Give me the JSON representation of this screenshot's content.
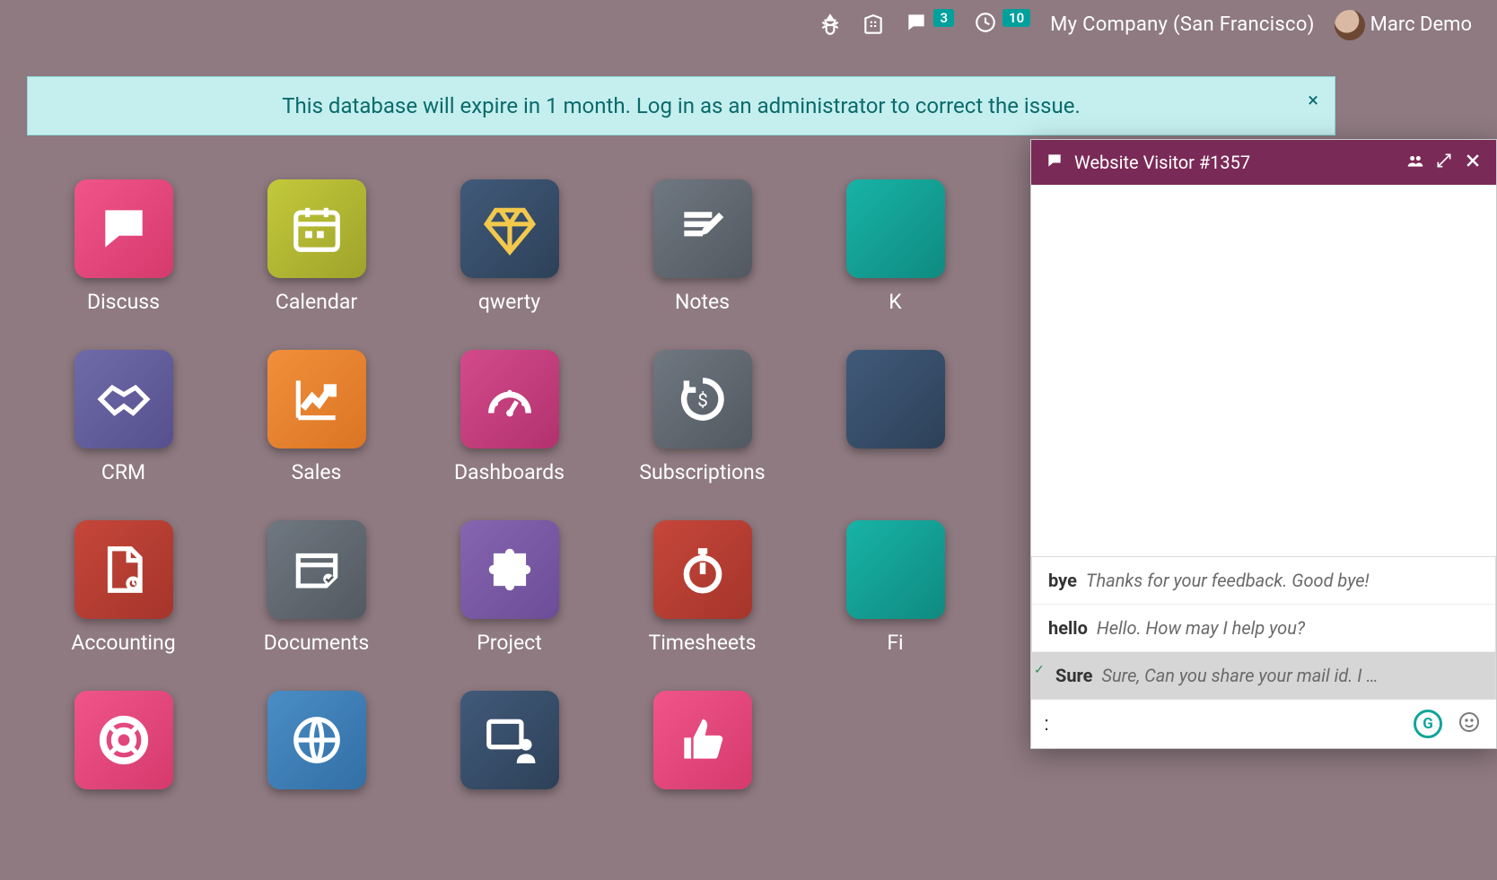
{
  "navbar": {
    "messages_badge": "3",
    "activities_badge": "10",
    "company": "My Company (San Francisco)",
    "user_name": "Marc Demo"
  },
  "alert": {
    "text": "This database will expire in 1 month. Log in as an administrator to correct the issue.",
    "close": "×"
  },
  "apps": [
    {
      "label": "Discuss",
      "tile": "g-pink",
      "icon": "chat"
    },
    {
      "label": "Calendar",
      "tile": "g-olive",
      "icon": "calendar"
    },
    {
      "label": "qwerty",
      "tile": "g-navy",
      "icon": "diamond"
    },
    {
      "label": "Notes",
      "tile": "g-slate",
      "icon": "notes"
    },
    {
      "label": "K",
      "tile": "g-teal",
      "icon": ""
    },
    {
      "label": "CRM",
      "tile": "g-violet",
      "icon": "handshake"
    },
    {
      "label": "Sales",
      "tile": "g-orange",
      "icon": "chart"
    },
    {
      "label": "Dashboards",
      "tile": "g-magenta",
      "icon": "gauge"
    },
    {
      "label": "Subscriptions",
      "tile": "g-slate",
      "icon": "cycle"
    },
    {
      "label": "",
      "tile": "g-navy",
      "icon": ""
    },
    {
      "label": "Accounting",
      "tile": "g-red",
      "icon": "file"
    },
    {
      "label": "Documents",
      "tile": "g-slate",
      "icon": "inbox"
    },
    {
      "label": "Project",
      "tile": "g-purple",
      "icon": "puzzle"
    },
    {
      "label": "Timesheets",
      "tile": "g-red",
      "icon": "timer"
    },
    {
      "label": "Fi",
      "tile": "g-teal",
      "icon": ""
    },
    {
      "label": "",
      "tile": "g-pink",
      "icon": "lifering"
    },
    {
      "label": "",
      "tile": "g-blue",
      "icon": "globe"
    },
    {
      "label": "",
      "tile": "g-navy",
      "icon": "teach"
    },
    {
      "label": "",
      "tile": "g-pink",
      "icon": "thumb"
    }
  ],
  "chat": {
    "title": "Website Visitor #1357",
    "suggestions": [
      {
        "kw": "bye",
        "txt": "Thanks for your feedback. Good bye!",
        "selected": false
      },
      {
        "kw": "hello",
        "txt": "Hello. How may I help you?",
        "selected": false
      },
      {
        "kw": "Sure",
        "txt": "Sure, Can you share your mail id. I …",
        "selected": true
      }
    ],
    "input_value": ":",
    "grammarly": "G"
  }
}
